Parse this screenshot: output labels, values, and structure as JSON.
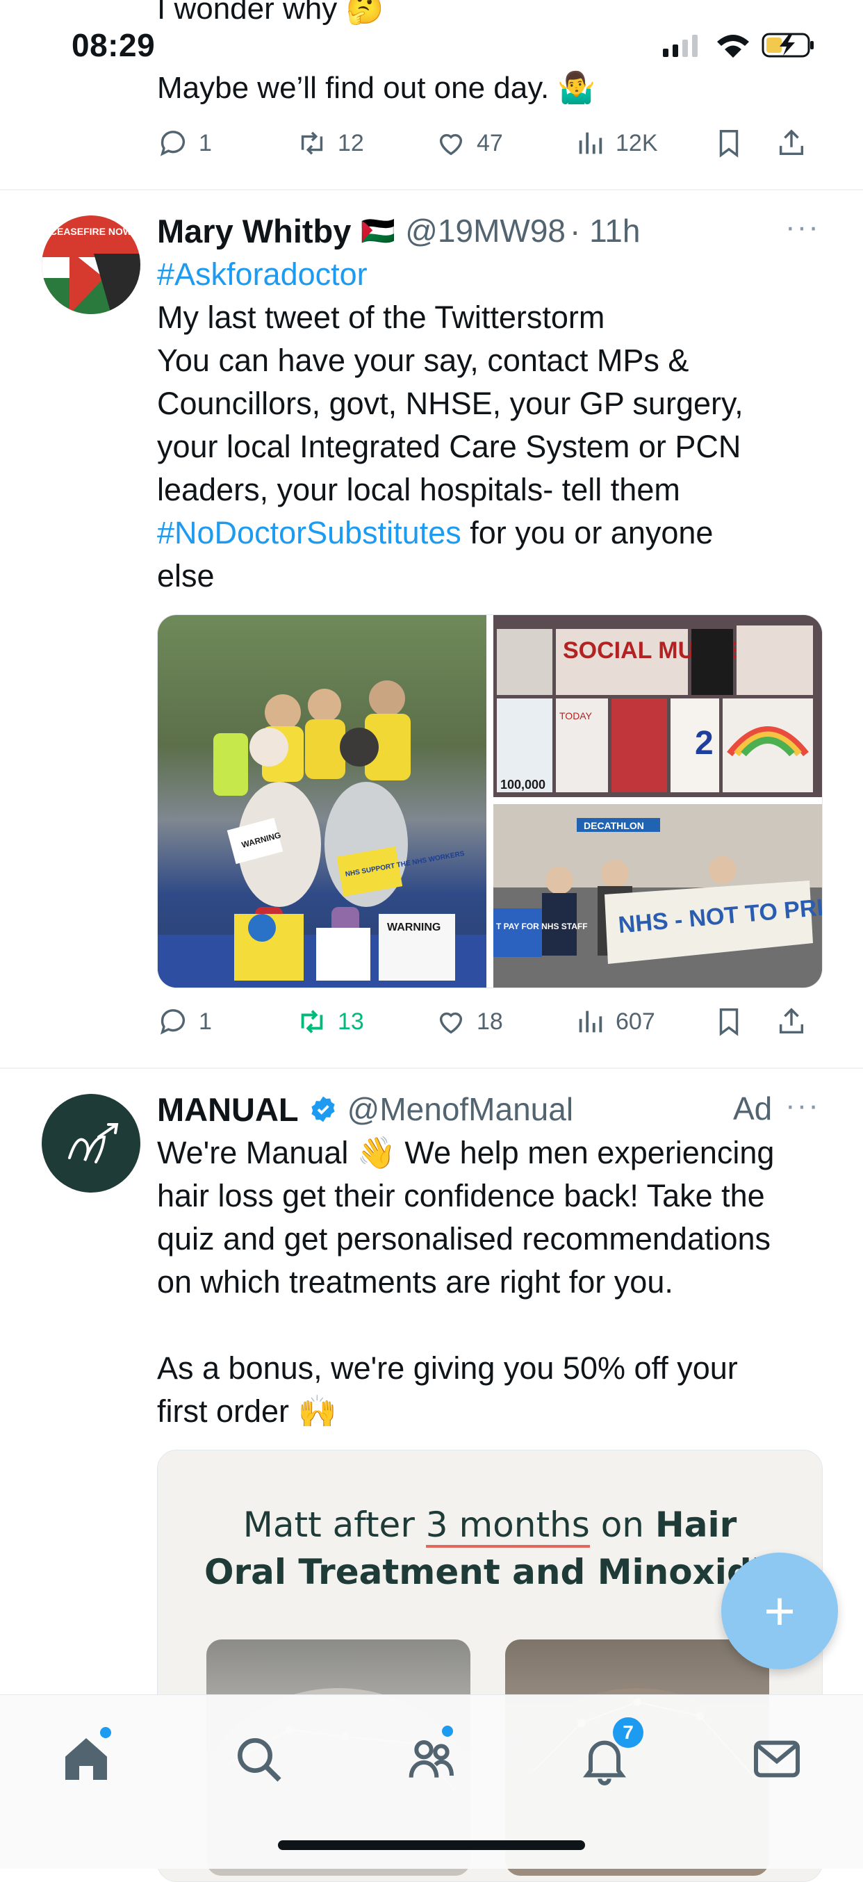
{
  "status_bar": {
    "time": "08:29"
  },
  "prev_tweet": {
    "text_line1": "I wonder why",
    "emoji1": "🤔",
    "text_line2": "Maybe we’ll find out one day.",
    "emoji2": "🤷‍♂️",
    "replies": "1",
    "retweets": "12",
    "likes": "47",
    "views": "12K"
  },
  "tweet": {
    "name": "Mary Whitby",
    "flag": "🇵🇸",
    "handle": "@19MW98",
    "time": "· 11h",
    "more": "···",
    "hashtag1": "#Askforadoctor",
    "lines": [
      "My last tweet of the Twitterstorm",
      "You can have your say, contact MPs &",
      "Councillors, govt, NHSE, your GP surgery,",
      "your local Integrated Care System or PCN",
      "leaders, your local hospitals- tell them"
    ],
    "hashtag2": "#NoDoctorSubstitutes",
    "line_after": " for you or anyone",
    "last_line": "else",
    "avatar_text": "CEASEFIRE NOW",
    "images": {
      "img1_placards": [
        "WARNING",
        "NHS SUPPORT THE NHS WORKERS",
        "WARNING"
      ],
      "img2_banner": "SOCIAL MURDER",
      "img2_extra": [
        "TODAY",
        "2",
        "100,000"
      ],
      "img3_banner": "NHS - NOT TO PRIVATISATION",
      "img3_store": "DECATHLON",
      "img3_side": "T PAY FOR NHS STAFF"
    },
    "replies": "1",
    "retweets": "13",
    "likes": "18",
    "views": "607",
    "retweet_color": "#00ba7c"
  },
  "ad": {
    "name": "MANUAL",
    "handle": "@MenofManual",
    "ad_label": "Ad",
    "more": "···",
    "lines": [
      "We're Manual 👋 We help men experiencing",
      "hair loss get their confidence back! Take the",
      "quiz and get personalised recommendations",
      "on which treatments are right for you."
    ],
    "bonus_lines": [
      "As a bonus, we're giving you 50% off your",
      "first order 🙌"
    ],
    "card_line1_a": "Matt after ",
    "card_line1_b": "3 months",
    "card_line1_c": " on ",
    "card_line1_d": "Hair",
    "card_line2": "Oral Treatment and Minoxidil"
  },
  "fab": {
    "label": "+"
  },
  "tabbar": {
    "notifications_badge": "7"
  },
  "colors": {
    "accent": "#1d9bf0",
    "text": "#0f1419",
    "muted": "#536471",
    "verified": "#1d9bf0"
  }
}
